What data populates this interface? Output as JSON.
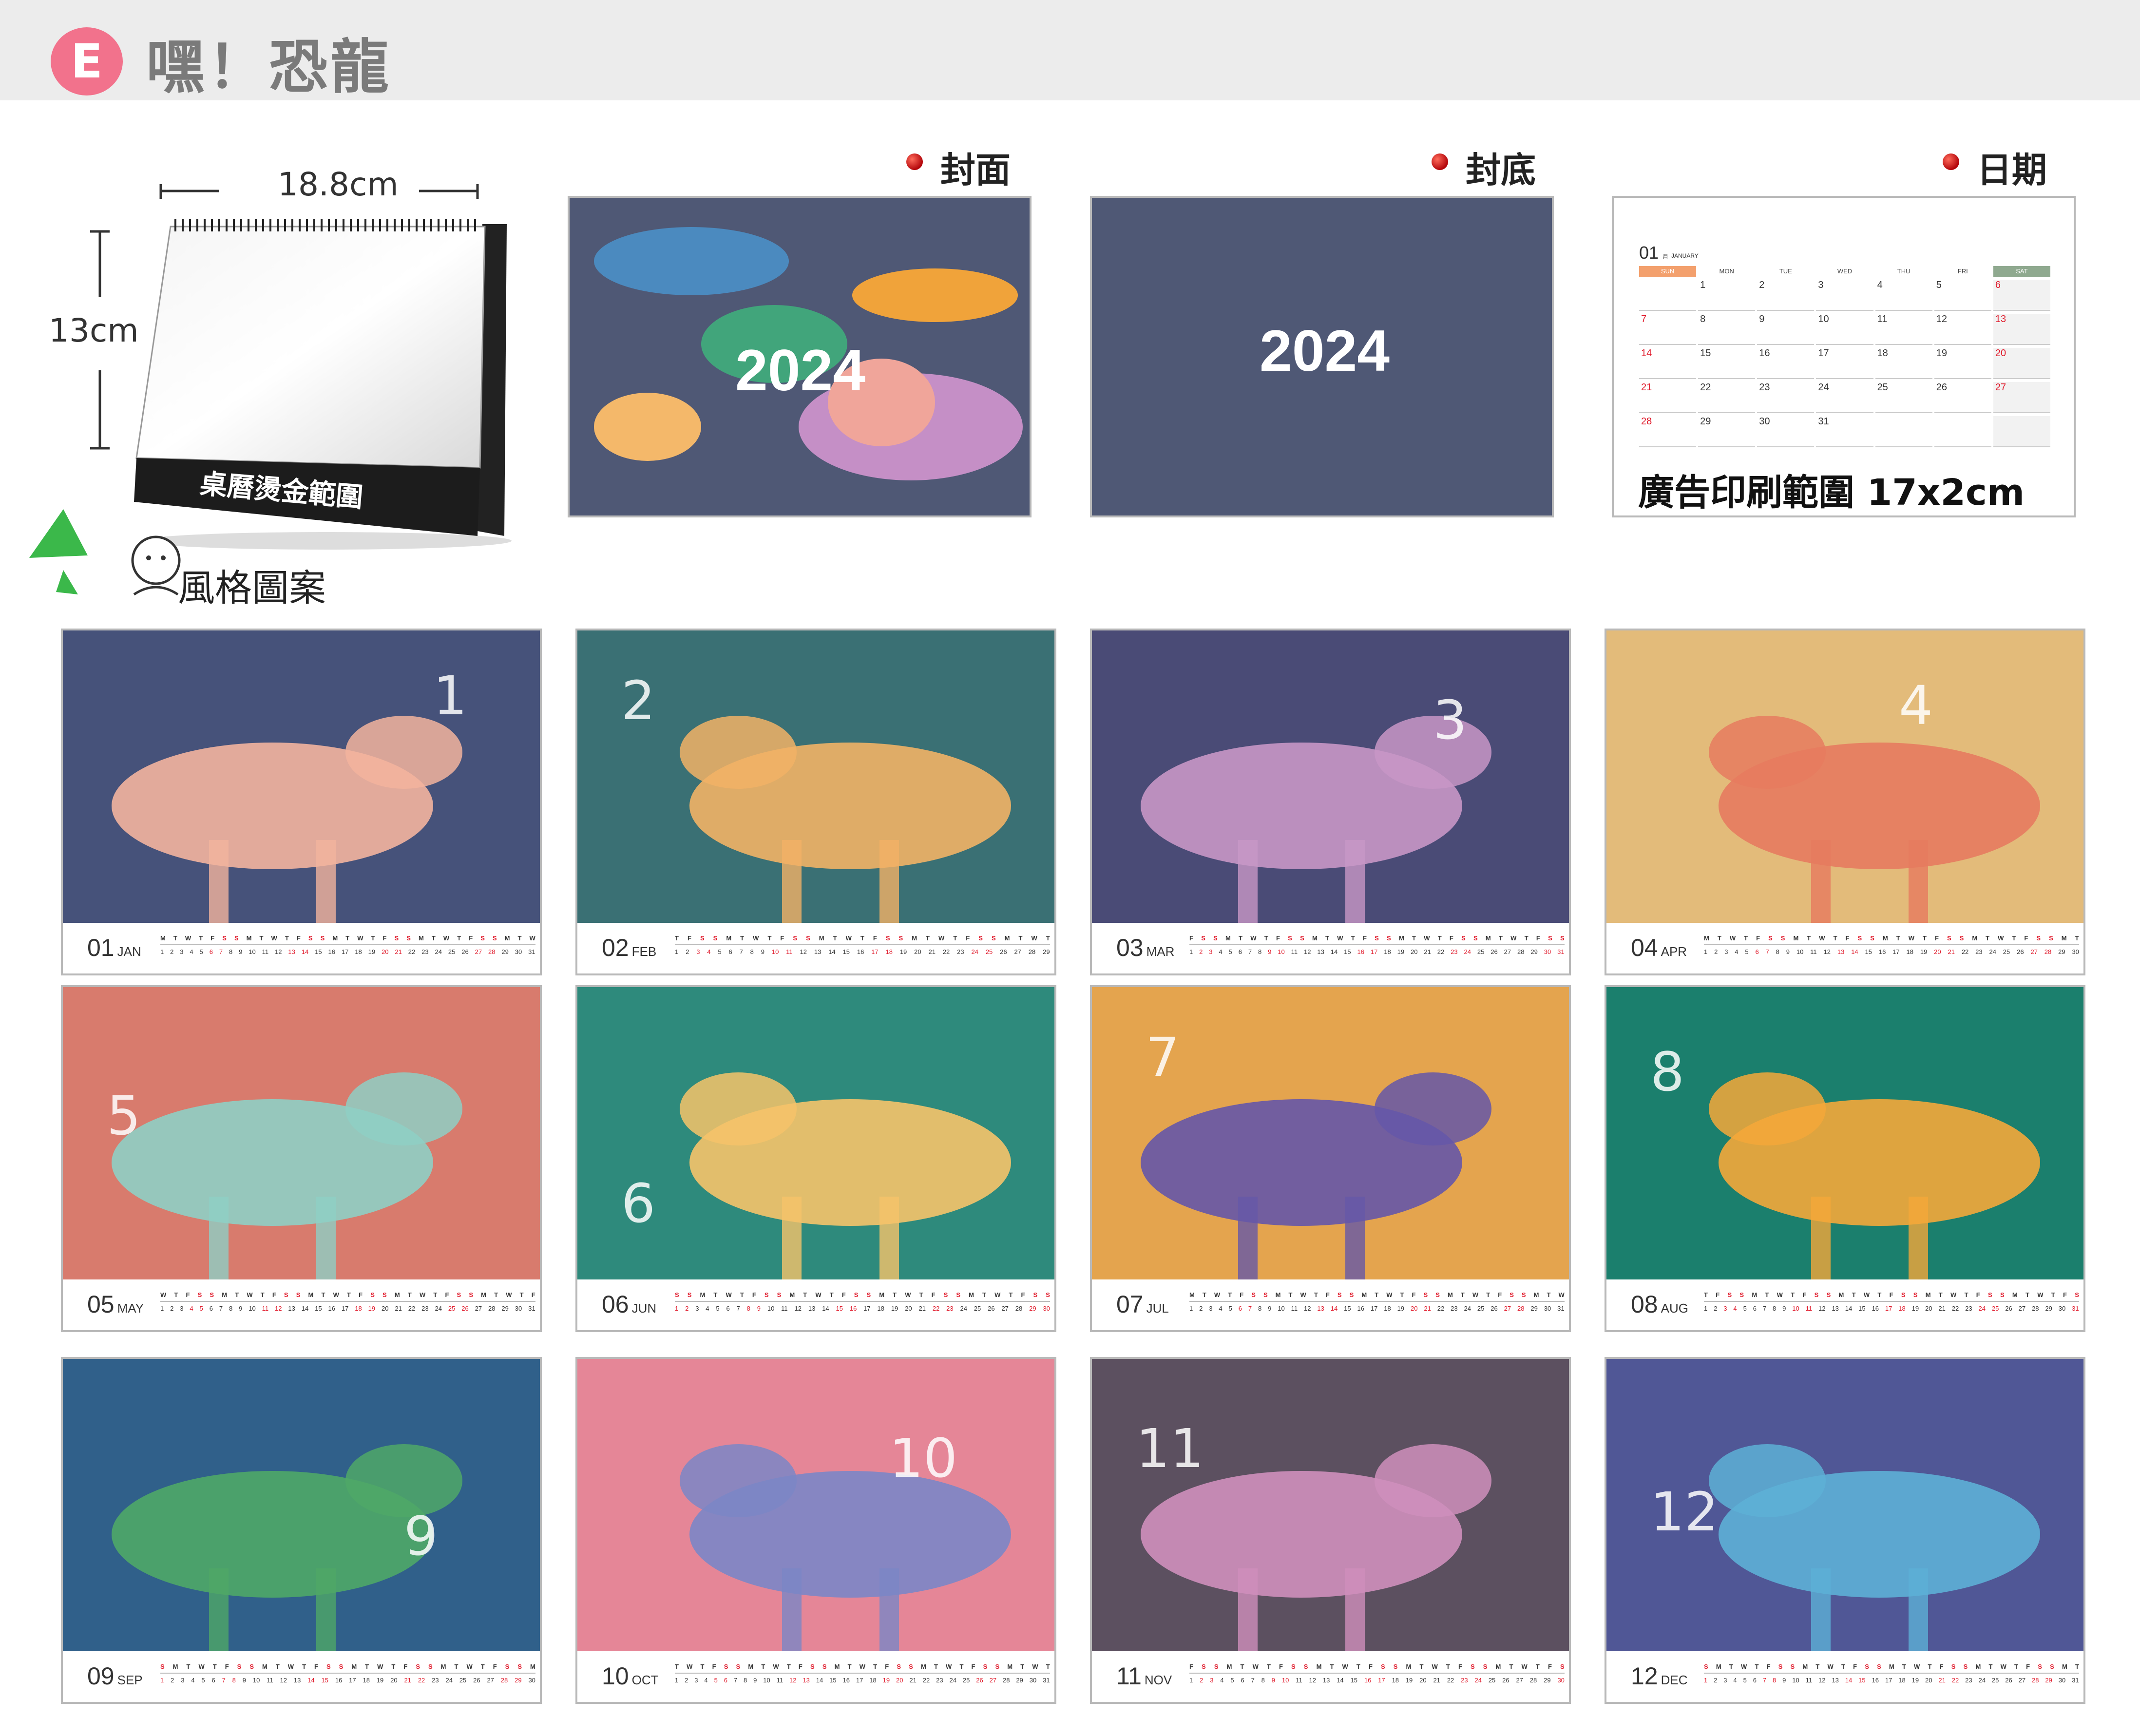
{
  "header": {
    "badge": "E",
    "title": "嘿！恐龍"
  },
  "product": {
    "width_label": "18.8cm",
    "height_label": "13cm",
    "base_label": "桌曆燙金範圍",
    "style_label": "風格圖案"
  },
  "previews": {
    "cover_label": "封面",
    "back_label": "封底",
    "date_label": "日期",
    "cover_year": "2024",
    "back_year": "2024",
    "ad_label": "廣告印刷範圍 17x2cm",
    "date_calendar": {
      "month_num": "01",
      "month_name": "JANUARY",
      "month_prefix": "月",
      "weekdays": [
        "SUN",
        "MON",
        "TUE",
        "WED",
        "THU",
        "FRI",
        "SAT"
      ],
      "weeks": [
        [
          "",
          "1",
          "2",
          "3",
          "4",
          "5",
          "6"
        ],
        [
          "7",
          "8",
          "9",
          "10",
          "11",
          "12",
          "13"
        ],
        [
          "14",
          "15",
          "16",
          "17",
          "18",
          "19",
          "20"
        ],
        [
          "21",
          "22",
          "23",
          "24",
          "25",
          "26",
          "27"
        ],
        [
          "28",
          "29",
          "30",
          "31",
          "",
          "",
          ""
        ]
      ]
    }
  },
  "colors": {
    "badge": "#f2728c",
    "cover_bg": "#4f5875",
    "date_red": "#e0192a",
    "months": [
      "#46527a",
      "#3a7074",
      "#4a4b76",
      "#e3bb7a",
      "#d87b6d",
      "#2e8a7c",
      "#e4a44e",
      "#1b7f6d",
      "#30608a",
      "#e58697",
      "#5c5060",
      "#505796"
    ]
  },
  "months": [
    {
      "num": "01",
      "name": "JAN",
      "days": 31,
      "start": 1,
      "hand": "1"
    },
    {
      "num": "02",
      "name": "FEB",
      "days": 29,
      "start": 4,
      "hand": "2"
    },
    {
      "num": "03",
      "name": "MAR",
      "days": 31,
      "start": 5,
      "hand": "3"
    },
    {
      "num": "04",
      "name": "APR",
      "days": 30,
      "start": 1,
      "hand": "4"
    },
    {
      "num": "05",
      "name": "MAY",
      "days": 31,
      "start": 3,
      "hand": "5"
    },
    {
      "num": "06",
      "name": "JUN",
      "days": 30,
      "start": 6,
      "hand": "6"
    },
    {
      "num": "07",
      "name": "JUL",
      "days": 31,
      "start": 1,
      "hand": "7"
    },
    {
      "num": "08",
      "name": "AUG",
      "days": 31,
      "start": 4,
      "hand": "8"
    },
    {
      "num": "09",
      "name": "SEP",
      "days": 30,
      "start": 0,
      "hand": "9"
    },
    {
      "num": "10",
      "name": "OCT",
      "days": 31,
      "start": 2,
      "hand": "10"
    },
    {
      "num": "11",
      "name": "NOV",
      "days": 30,
      "start": 5,
      "hand": "11"
    },
    {
      "num": "12",
      "name": "DEC",
      "days": 31,
      "start": 0,
      "hand": "12"
    }
  ],
  "weekday_letters": [
    "S",
    "M",
    "T",
    "W",
    "T",
    "F",
    "S"
  ]
}
